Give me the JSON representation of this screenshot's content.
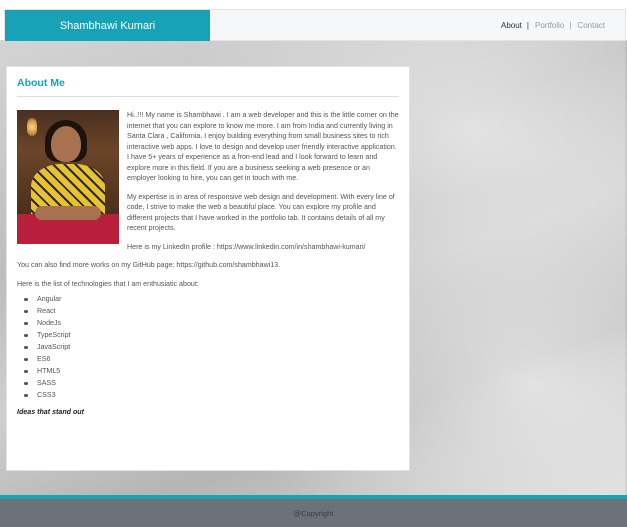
{
  "navbar": {
    "brand": "Shambhawi Kumari",
    "links": [
      {
        "label": "About",
        "sep": "|"
      },
      {
        "label": "Portfolio",
        "sep": "|"
      },
      {
        "label": "Contact"
      }
    ],
    "accent_color": "#17a2b8"
  },
  "about": {
    "title": "About Me",
    "photo_icon": "profile-photo",
    "p1": "Hi..!!! My name is Shambhawi . I am a web developer and this is the little corner on the internet that you can explore to know me more. I am from India and currently living in Santa Clara , California. I enjoy building everything from small business sites to rich interactive web apps. I love to design and develop user friendly interactive application. I have 5+ years of experience as a fron-end lead and I look forward to learn and explore more in this field. If you are a business seeking a web presence or an employer looking to hire, you can get in touch with me.",
    "p2": "My expertise is in area of responsive web design and development. With every line of code, I strive to make the web a beautiful place. You can explore my profile and different projects that I have worked in the portfolio tab. It contains details of all my recent projects.",
    "linkedin": "Here is my LinkedIn profile : https://www.linkedin.com/in/shambhawi-kumari/",
    "github": "You can also find more works on my GitHub page: https://github.com/shambhawi13.",
    "tech_intro": "Here is the list of technologies that I am enthusiatic about:",
    "technologies": [
      "Angular",
      "React",
      "NodeJs",
      "TypeScript",
      "JavaScript",
      "ES6",
      "HTML5",
      "SASS",
      "CSS3"
    ],
    "ideas": "Ideas that stand out"
  },
  "footer": {
    "text": "@Copyright"
  }
}
